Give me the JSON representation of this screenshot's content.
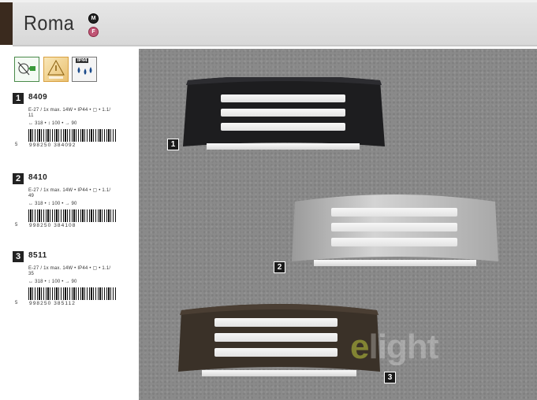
{
  "header": {
    "title": "Roma",
    "icon_m": "M",
    "icon_f": "F"
  },
  "certifications": {
    "cert1_icon": "energy-lamp-icon",
    "cert2_icon": "lamp-warning-icon",
    "cert3_label": "IP44",
    "cert3_icon": "water-drops-icon"
  },
  "products": [
    {
      "number": "1",
      "code": "8409",
      "spec_line1": "E-27 / 1x max. 14W • IP44 • ▢ • 1.1/",
      "spec_line2": "11",
      "dims": "↔ 318 • ↕ 100 • → 90",
      "barcode_lead": "5",
      "barcode_digits": "998250 384092"
    },
    {
      "number": "2",
      "code": "8410",
      "spec_line1": "E-27 / 1x max. 14W • IP44 • ▢ • 1.1/",
      "spec_line2": "49",
      "dims": "↔ 318 • ↕ 100 • → 90",
      "barcode_lead": "5",
      "barcode_digits": "998250 384108"
    },
    {
      "number": "3",
      "code": "8511",
      "spec_line1": "E-27 / 1x max. 14W • IP44 • ▢ • 1.1/",
      "spec_line2": "35",
      "dims": "↔ 318 • ↕ 100 • → 90",
      "barcode_lead": "5",
      "barcode_digits": "998250 385112"
    }
  ],
  "photo": {
    "label1": "1",
    "label2": "2",
    "label3": "3",
    "watermark_e": "e",
    "watermark_rest": "light",
    "lamp1_color": "#1c1c1c",
    "lamp2_color": "#b8b8b8",
    "lamp3_color": "#3a3128"
  }
}
